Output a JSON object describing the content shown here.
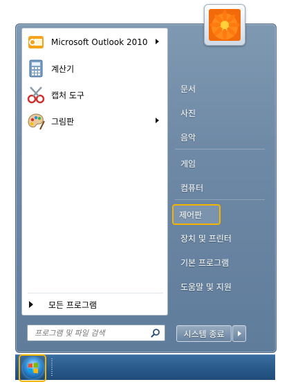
{
  "programs": [
    {
      "label": "Microsoft Outlook 2010",
      "icon": "outlook-icon",
      "has_submenu": true
    },
    {
      "label": "계산기",
      "icon": "calculator-icon",
      "has_submenu": false
    },
    {
      "label": "캡처 도구",
      "icon": "snipping-tool-icon",
      "has_submenu": false
    },
    {
      "label": "그림판",
      "icon": "paint-icon",
      "has_submenu": true
    }
  ],
  "all_programs": "모든 프로그램",
  "search": {
    "placeholder": "프로그램 및 파일 검색"
  },
  "right_items": [
    "문서",
    "사진",
    "음악",
    "게임",
    "컴퓨터",
    "제어판",
    "장치 및 프린터",
    "기본 프로그램",
    "도움말 및 지원"
  ],
  "highlighted_item": "제어판",
  "shutdown": {
    "label": "시스템 종료"
  },
  "highlight_color": "#f4b400",
  "taskbar_color": "#2a5b8c"
}
